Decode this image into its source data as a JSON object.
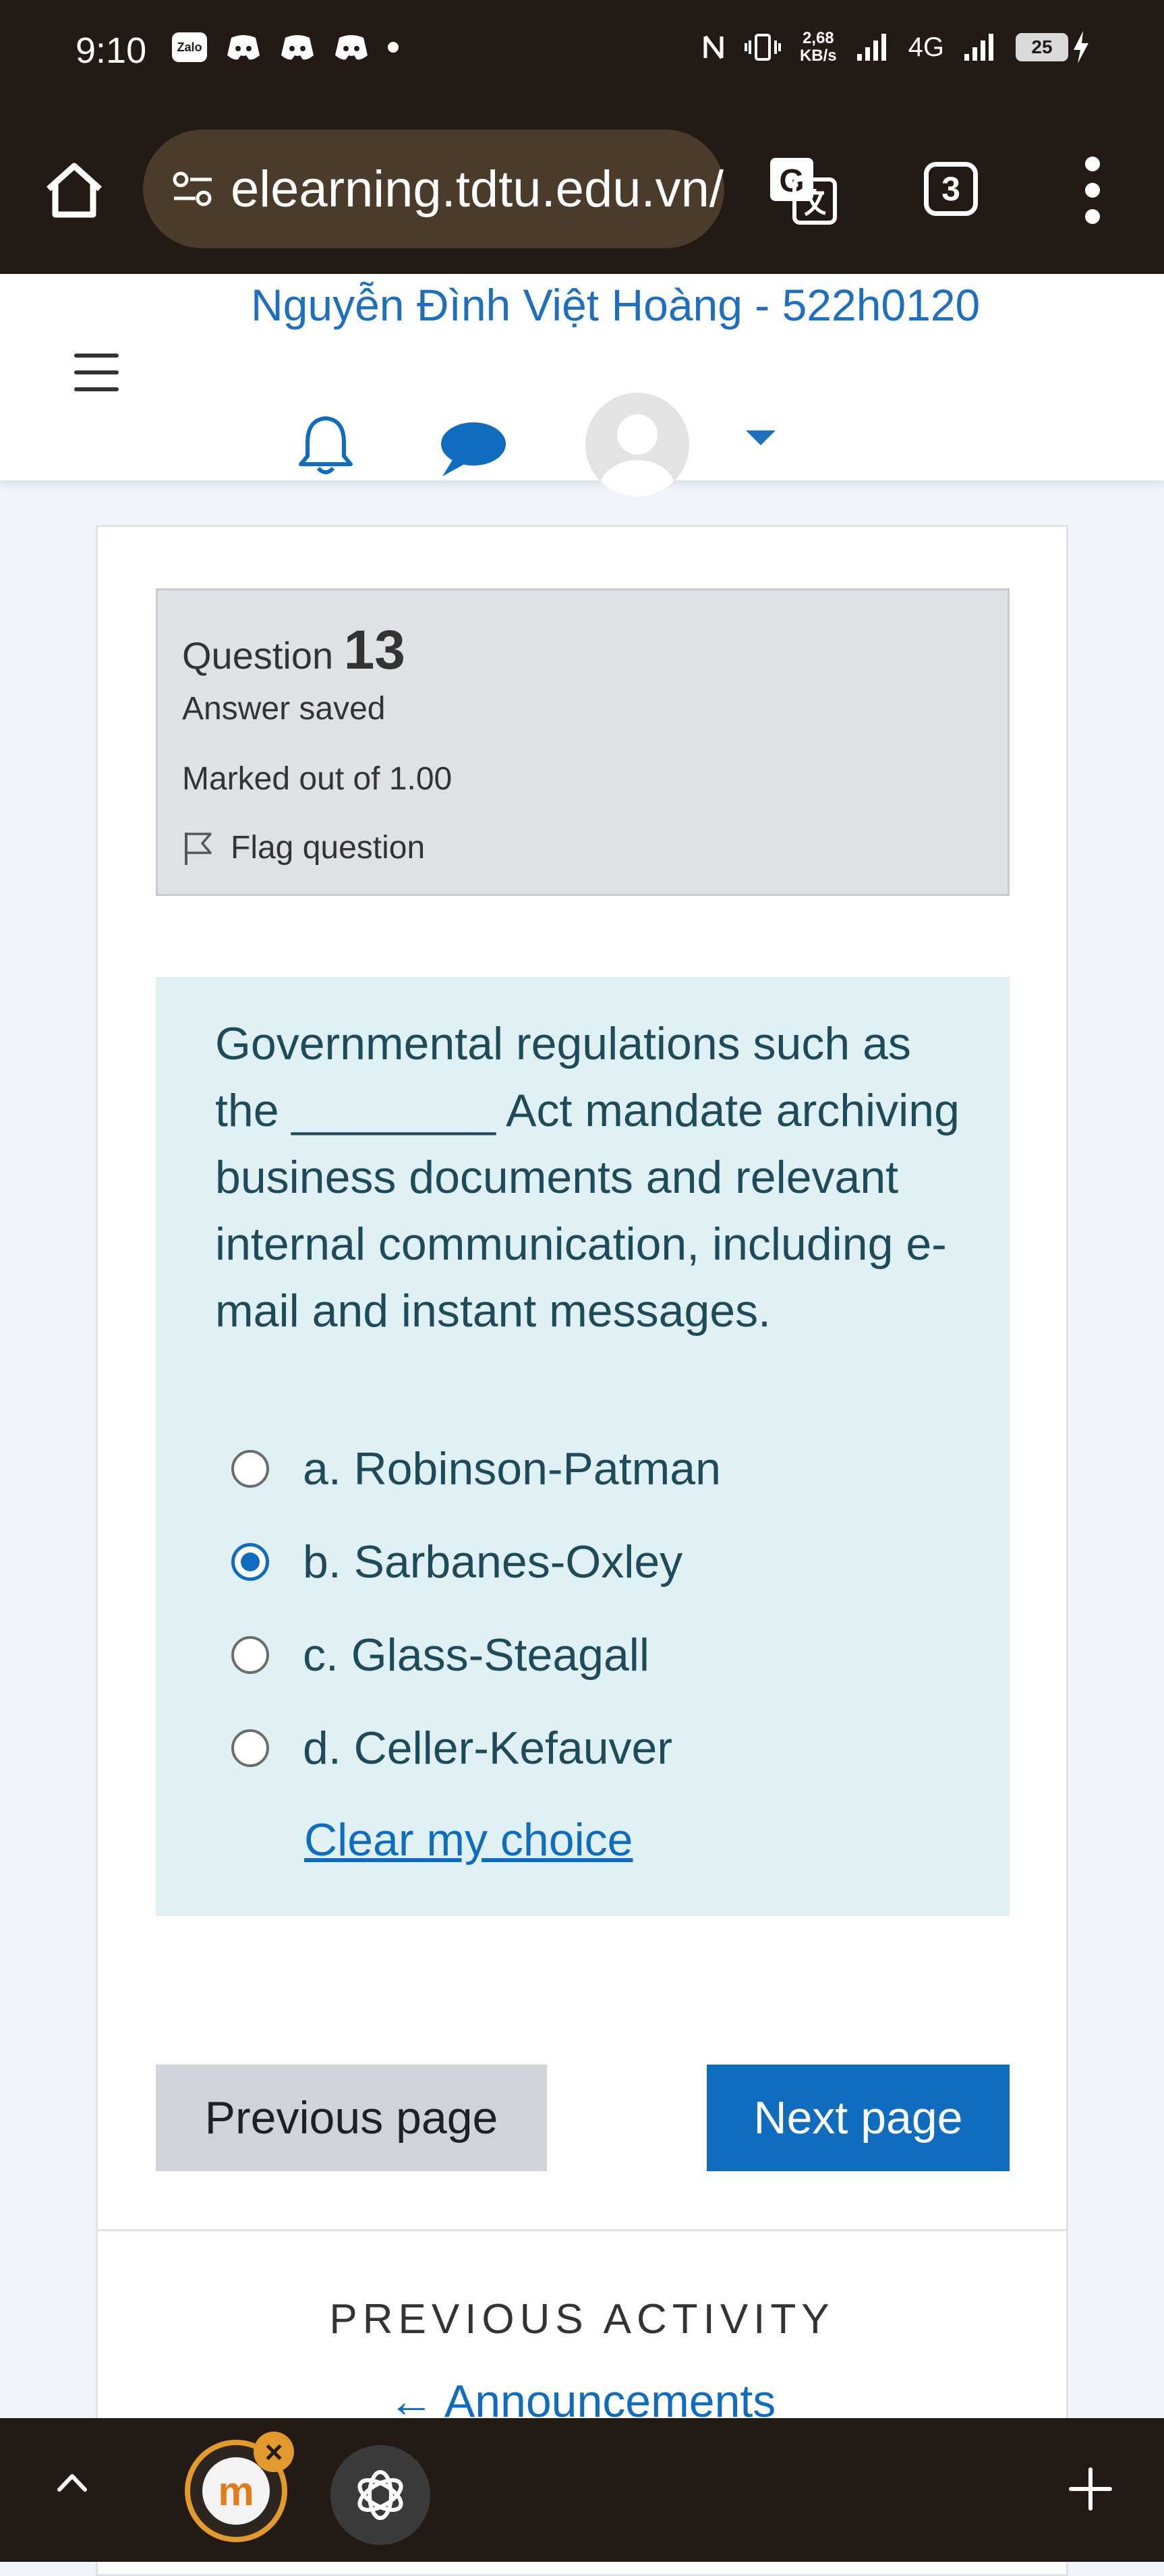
{
  "status_bar": {
    "time": "9:10",
    "left_icons": [
      "zalo-icon",
      "discord-icon",
      "discord-icon",
      "discord-icon"
    ],
    "zalo_label": "Zalo",
    "net_speed_value": "2,68",
    "net_speed_unit": "KB/s",
    "network": "4G",
    "battery": "25"
  },
  "browser": {
    "url": "elearning.tdtu.edu.vn/",
    "tab_count": "3"
  },
  "header": {
    "user_name": "Nguyễn Đình Việt Hoàng - 522h0120"
  },
  "question": {
    "label": "Question",
    "number": "13",
    "state": "Answer saved",
    "grade": "Marked out of 1.00",
    "flag_label": "Flag question",
    "text": "Governmental regulations such as the ________ Act mandate archiving business documents and relevant internal communication, including e-mail and instant messages.",
    "options": [
      {
        "label": "a. Robinson-Patman",
        "checked": false
      },
      {
        "label": "b. Sarbanes-Oxley",
        "checked": true
      },
      {
        "label": "c. Glass-Steagall",
        "checked": false
      },
      {
        "label": "d. Celler-Kefauver",
        "checked": false
      }
    ],
    "clear_choice": "Clear my choice"
  },
  "navigation": {
    "previous": "Previous page",
    "next": "Next page"
  },
  "activity": {
    "heading": "PREVIOUS ACTIVITY",
    "link": "← Announcements"
  },
  "colors": {
    "accent": "#0f6cbf",
    "system_bar": "#241a15"
  }
}
